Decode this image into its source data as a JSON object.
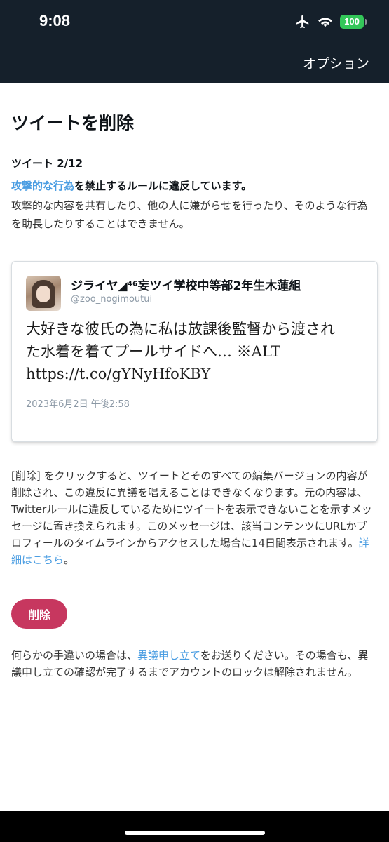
{
  "status_bar": {
    "time": "9:08",
    "battery": "100",
    "battery_color": "#33c759"
  },
  "header": {
    "option_label": "オプション"
  },
  "page": {
    "title": "ツイートを削除",
    "tweet_count": "ツイート 2/12",
    "rule_link": "攻撃的な行為",
    "rule_text": "を禁止するルールに違反しています。",
    "rule_description": "攻撃的な内容を共有したり、他の人に嫌がらせを行ったり、そのような行為を助長したりすることはできません。"
  },
  "tweet": {
    "display_name": "ジライヤ◢⁴⁶妄ツイ学校中等部2年生木蓮組",
    "handle": "@zoo_nogimoutui",
    "text": "大好きな彼氏の為に私は放課後監督から渡された水着を着てプールサイドへ… ※ALT https://t.co/gYNyHfoKBY",
    "date": "2023年6月2日 午後2:58"
  },
  "explanation": {
    "text": "[削除] をクリックすると、ツイートとそのすべての編集バージョンの内容が削除され、この違反に異議を唱えることはできなくなります。元の内容は、Twitterルールに違反しているためにツイートを表示できないことを示すメッセージに置き換えられます。このメッセージは、該当コンテンツにURLかプロフィールのタイムラインからアクセスした場合に14日間表示されます。",
    "link": "詳細はこちら",
    "end": "。"
  },
  "delete_button": {
    "label": "削除",
    "color": "#c7375f"
  },
  "appeal": {
    "before": "何らかの手違いの場合は、",
    "link": "異議申し立て",
    "after": "をお送りください。その場合も、異議申し立ての確認が完了するまでアカウントのロックは解除されません。"
  },
  "colors": {
    "header_bg": "#15202b",
    "link": "#4a9de2"
  }
}
